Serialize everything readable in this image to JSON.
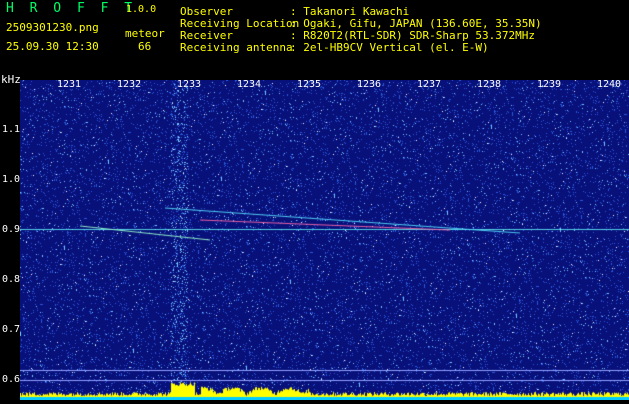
{
  "app": {
    "name": "H R O F F T",
    "version": "1.0.0"
  },
  "file": {
    "name": "2509301230.png",
    "timestamp": "25.09.30 12:30"
  },
  "detection": {
    "type": "meteor",
    "count": "66"
  },
  "info": [
    {
      "key": "Observer",
      "value": ": Takanori Kawachi"
    },
    {
      "key": "Receiving Location",
      "value": ": Ogaki, Gifu, JAPAN (136.60E, 35.35N)"
    },
    {
      "key": "Receiver",
      "value": ": R820T2(RTL-SDR) SDR-Sharp 53.372MHz"
    },
    {
      "key": "Receiving antenna",
      "value": ": 2el-HB9CV Vertical (el. E-W)"
    }
  ],
  "axis": {
    "unit": "kHz",
    "y_labels": [
      "1.1",
      "1.0",
      "0.9",
      "0.8",
      "0.7",
      "0.6"
    ],
    "x_labels": [
      "1231",
      "1232",
      "1233",
      "1234",
      "1235",
      "1236",
      "1237",
      "1238",
      "1239",
      "1240"
    ]
  },
  "colors": {
    "background": "#08107a",
    "text_green": "#00ff66",
    "text_yellow": "#ffff00",
    "carrier": "#66ffff",
    "power": "#ffff00"
  }
}
